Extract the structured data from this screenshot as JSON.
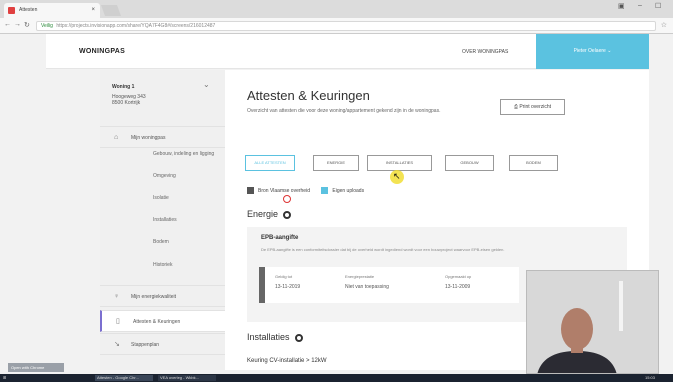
{
  "browser": {
    "tab_title": "Attesten",
    "tab_close": "×",
    "secure_label": "Veilig",
    "url": "https://projects.invisionapp.com/share/YQA7F4G8#/screens/216012487",
    "window_controls": [
      "▣",
      "–",
      "☐"
    ]
  },
  "site": {
    "logo": "WONINGPAS",
    "nav_over": "OVER WONINGPAS",
    "user": "Pieter Oelaere ⌄"
  },
  "sidebar": {
    "dwelling_title": "Woning 1",
    "dwelling_address": [
      "Hoogeweg 343",
      "8500 Kortrijk"
    ],
    "items": [
      {
        "label": "Mijn woningpas",
        "icon": "home-icon",
        "kind": "top"
      },
      {
        "label": "Gebouw, indeling en ligging",
        "kind": "sub"
      },
      {
        "label": "Omgeving",
        "kind": "sub"
      },
      {
        "label": "Isolatie",
        "kind": "sub"
      },
      {
        "label": "Installaties",
        "kind": "sub"
      },
      {
        "label": "Bodem",
        "kind": "sub"
      },
      {
        "label": "Historiek",
        "kind": "sub"
      },
      {
        "label": "Mijn energiekwaliteit",
        "icon": "bulb-icon",
        "kind": "top"
      },
      {
        "label": "Attesten & Keuringen",
        "icon": "document-icon",
        "kind": "top",
        "active": true
      },
      {
        "label": "Stappenplan",
        "icon": "arrow-icon",
        "kind": "top"
      }
    ]
  },
  "main": {
    "title": "Attesten & Keuringen",
    "subtitle": "Overzicht van attesten die voor deze woning/appartement gekend zijn in de woningpas.",
    "print_label": "Print overzicht",
    "filter_tabs": [
      "ALLE ATTESTEN",
      "ENERGIE",
      "INSTALLATIES",
      "GEBOUW",
      "BODEM"
    ],
    "legend": {
      "flanders": "Bron Vlaamse overheid",
      "uploads": "Eigen uploads"
    },
    "section_energy": "Energie",
    "epb": {
      "title": "EPB-aangifte",
      "desc": "De EPB-aangifte is een conformiteitsdossier dat bij de overheid wordt ingediend wordt voor een bouwproject waarvoor EPB-eisen gelden.",
      "fields": [
        {
          "label": "Geldig tot",
          "value": "13-11-2019"
        },
        {
          "label": "Energieprestatie",
          "value": "Niet van toepassing"
        },
        {
          "label": "Opgemaakt op",
          "value": "13-11-2009"
        }
      ]
    },
    "section_installations": "Installaties",
    "cv_title": "Keuring CV-installatie > 12kW"
  },
  "taskbar": {
    "items": [
      "Attesten - Google Chr...",
      "VEA overleg - Wkbk..."
    ],
    "clock": "15:03",
    "overlay": "Open with Chrome"
  },
  "colors": {
    "accent": "#5bc2e0",
    "flanders": "#555555",
    "uploads": "#5bc2e0",
    "active_border": "#7b6fd0"
  }
}
